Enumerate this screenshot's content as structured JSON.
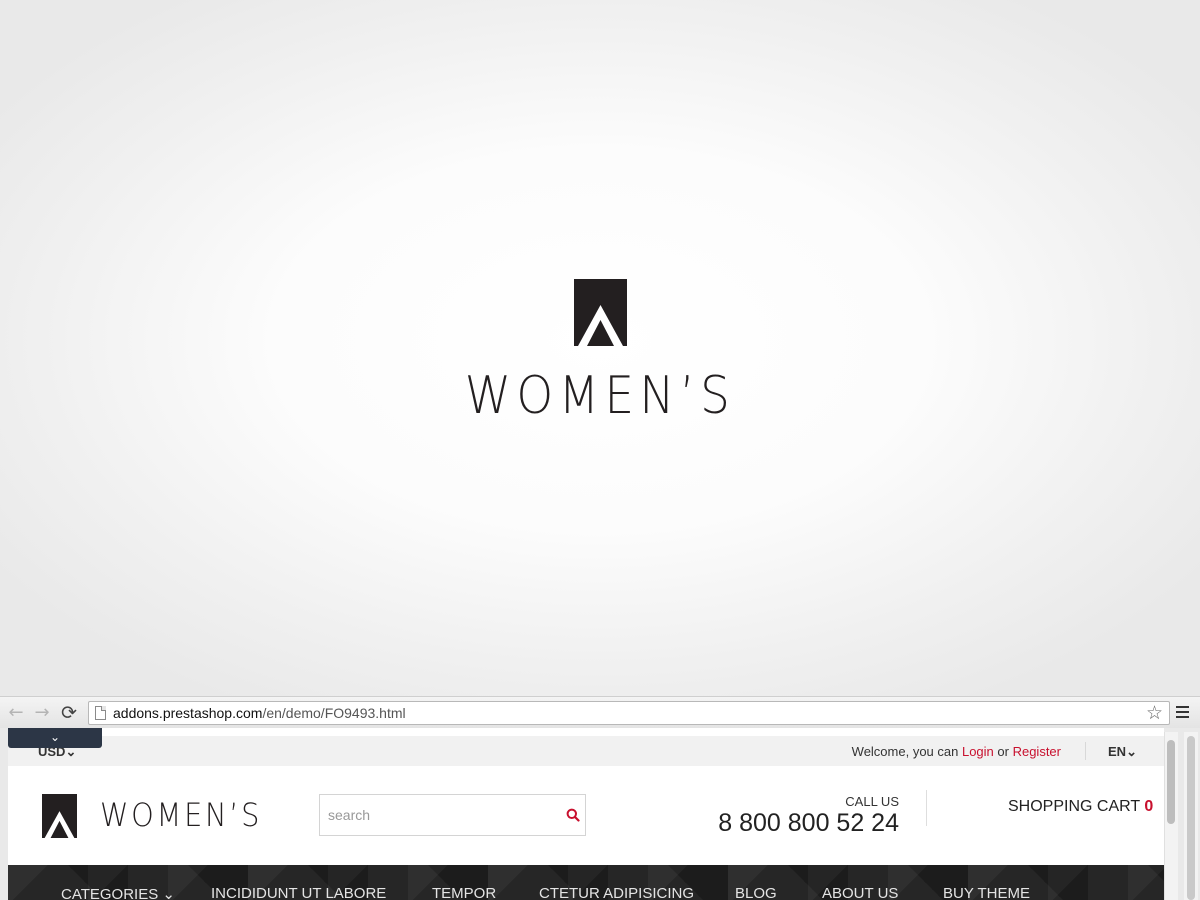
{
  "splash": {
    "brand_title": "WOMEN’S",
    "logo_icon": "womens-logo-icon"
  },
  "browser": {
    "url_domain": "addons.prestashop.com",
    "url_path": "/en/demo/FO9493.html",
    "back_icon": "←",
    "forward_icon": "→",
    "reload_icon": "⟳",
    "star_icon": "☆",
    "dropdown_icon": "⌄"
  },
  "site": {
    "topbar": {
      "currency": "USD",
      "currency_caret": "⌄",
      "welcome_prefix": "Welcome, you can ",
      "login": "Login",
      "or": " or ",
      "register": "Register",
      "language": "EN",
      "language_caret": "⌄"
    },
    "header": {
      "brand_title": "WOMEN’S",
      "search_placeholder": "search",
      "call_label": "CALL US",
      "phone": "8 800 800 52 24",
      "cart_label": "SHOPPING CART ",
      "cart_count": "0"
    },
    "nav": {
      "items": [
        "CATEGORIES ⌄",
        "INCIDIDUNT UT LABORE",
        "TEMPOR",
        "CTETUR ADIPISICING",
        "BLOG",
        "ABOUT US",
        "BUY THEME"
      ]
    }
  },
  "colors": {
    "accent": "#c8102e",
    "logo": "#231f20",
    "navbar": "#262626",
    "dropdown_tab": "#2c3646"
  }
}
